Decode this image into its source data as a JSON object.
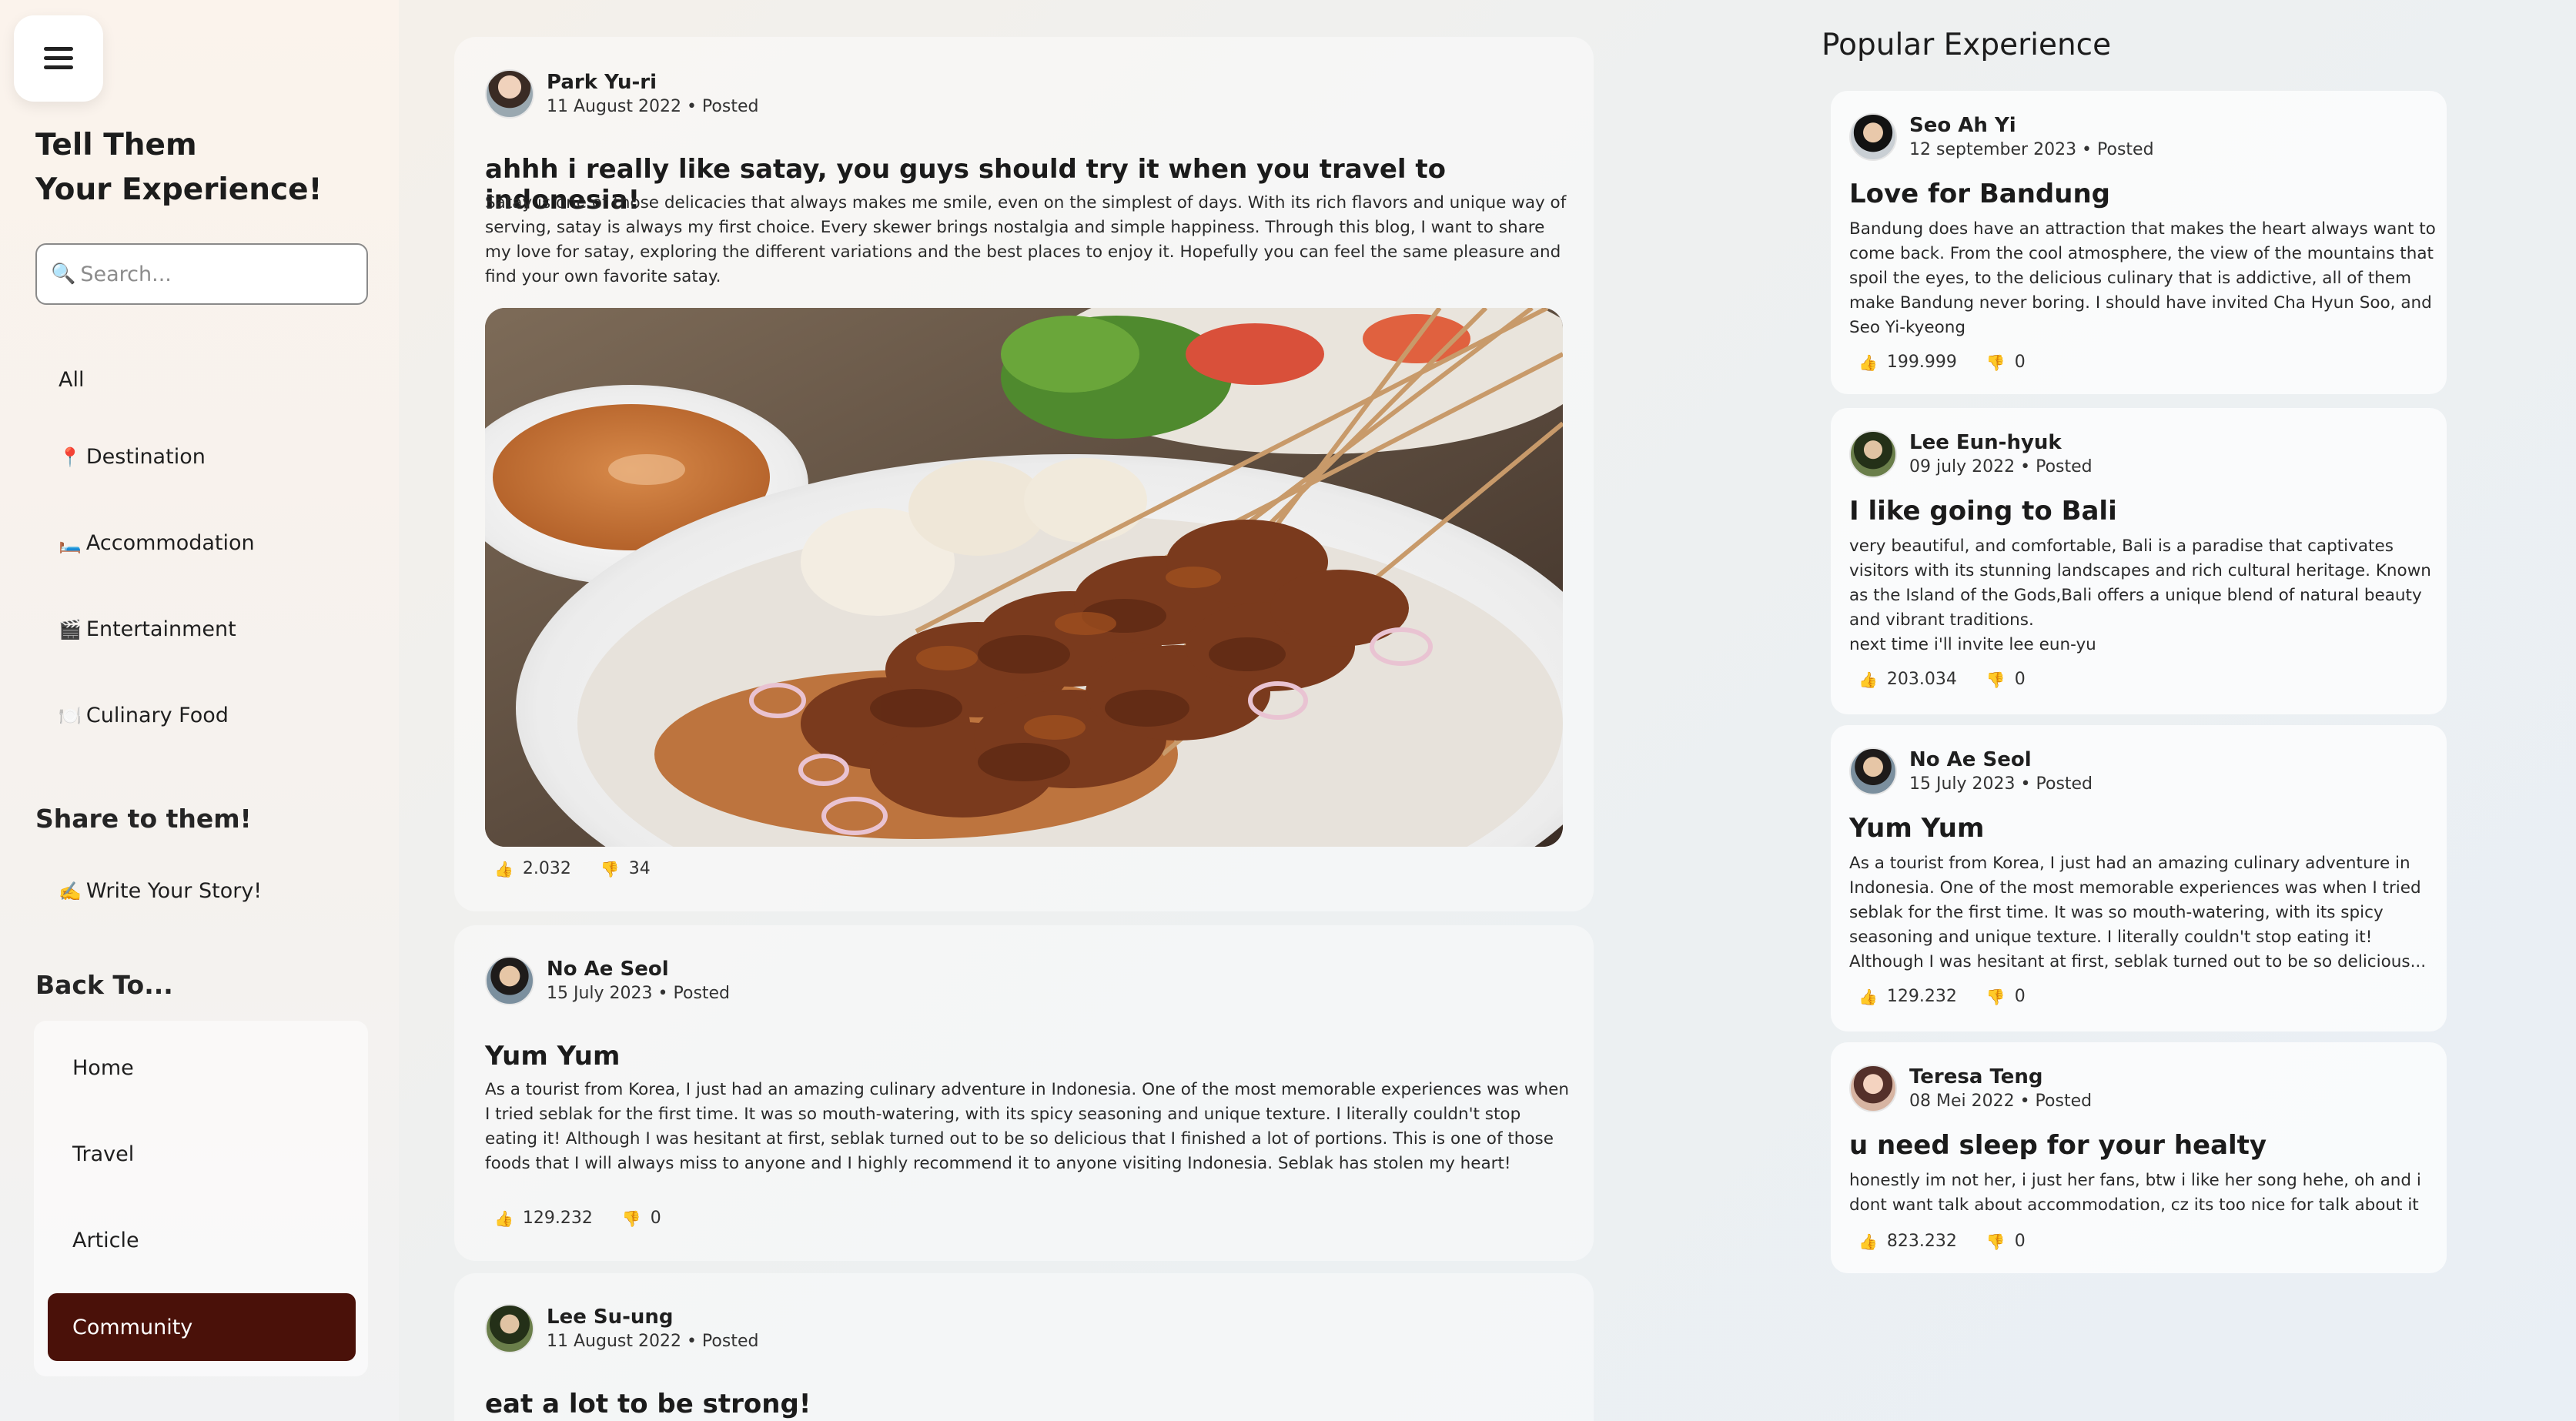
{
  "sidebar": {
    "menu_icon": "hamburger-menu-icon",
    "title_line1": "Tell Them",
    "title_line2": "Your Experience!",
    "search_placeholder": "Search...",
    "categories": [
      {
        "icon": "",
        "label": "All"
      },
      {
        "icon": "📍",
        "label": "Destination"
      },
      {
        "icon": "🛏️",
        "label": "Accommodation"
      },
      {
        "icon": "🎬",
        "label": "Entertainment"
      },
      {
        "icon": "🍽️",
        "label": "Culinary Food"
      }
    ],
    "share_heading": "Share to them!",
    "write_story": {
      "icon": "✍️",
      "label": "Write Your Story!"
    },
    "back_heading": "Back To...",
    "back_items": [
      "Home",
      "Travel",
      "Article",
      "Community"
    ],
    "active_back_item": "Community",
    "accent_color": "#4a1109"
  },
  "feed": [
    {
      "author": "Park Yu-ri",
      "meta": "11 August 2022 • Posted",
      "title": "ahhh i really like satay, you guys should try it when you travel to indonesia!",
      "body": "Satay is one of those delicacies that always makes me smile, even on the simplest of days. With its rich flavors and unique way of serving, satay is always my first choice. Every skewer brings nostalgia and simple happiness. Through this blog, I want to share my love for satay, exploring the different variations and the best places to enjoy it. Hopefully you can feel the same pleasure and find your own favorite satay.",
      "image": "satay-food-photo",
      "likes": "2.032",
      "dislikes": "34"
    },
    {
      "author": "No Ae Seol",
      "meta": "15 July 2023 • Posted",
      "title": "Yum Yum",
      "body": "As a tourist from Korea, I just had an amazing culinary adventure in Indonesia. One of the most memorable experiences was when I tried seblak for the first time. It was so mouth-watering, with its spicy seasoning and unique texture. I literally couldn't stop eating it! Although I was hesitant at first, seblak turned out to be so delicious that I finished a lot of portions. This is one of those foods that I will always miss to anyone and I highly recommend it to anyone visiting Indonesia. Seblak has stolen my heart!",
      "likes": "129.232",
      "dislikes": "0"
    },
    {
      "author": "Lee Su-ung",
      "meta": "11 August 2022 • Posted",
      "title": "eat a lot to be strong!"
    }
  ],
  "popular": {
    "heading": "Popular Experience",
    "items": [
      {
        "author": "Seo Ah Yi",
        "meta": "12 september 2023 • Posted",
        "title": "Love for Bandung",
        "body": "Bandung does have an attraction that makes the heart always want to come back. From the cool atmosphere, the view of the mountains that spoil the eyes, to the delicious culinary that is addictive, all of them make Bandung never boring. I should have invited Cha Hyun Soo, and Seo Yi-kyeong",
        "likes": "199.999",
        "dislikes": "0"
      },
      {
        "author": "Lee Eun-hyuk",
        "meta": "09 july 2022 • Posted",
        "title": "I like going to Bali",
        "body": "very beautiful, and comfortable, Bali is a paradise that captivates visitors with its stunning landscapes and rich cultural heritage. Known as the Island of the Gods,Bali offers a unique blend of natural beauty and vibrant traditions.\nnext time i'll invite lee eun-yu",
        "likes": "203.034",
        "dislikes": "0"
      },
      {
        "author": "No Ae Seol",
        "meta": "15 July 2023 • Posted",
        "title": "Yum Yum",
        "body": "As a tourist from Korea, I just had an amazing culinary adventure in Indonesia. One of the most memorable experiences was when I tried seblak for the first time. It was so mouth-watering, with its spicy seasoning and unique texture. I literally couldn't stop eating it! Although I was hesitant at first, seblak turned out to be so delicious...",
        "likes": "129.232",
        "dislikes": "0"
      },
      {
        "author": "Teresa Teng",
        "meta": "08 Mei 2022 • Posted",
        "title": "u need sleep for your healty",
        "body": "honestly im not her, i just her fans, btw i like her song hehe, oh and i dont want talk about accommodation, cz its too nice for talk about it",
        "likes": "823.232",
        "dislikes": "0"
      }
    ]
  }
}
